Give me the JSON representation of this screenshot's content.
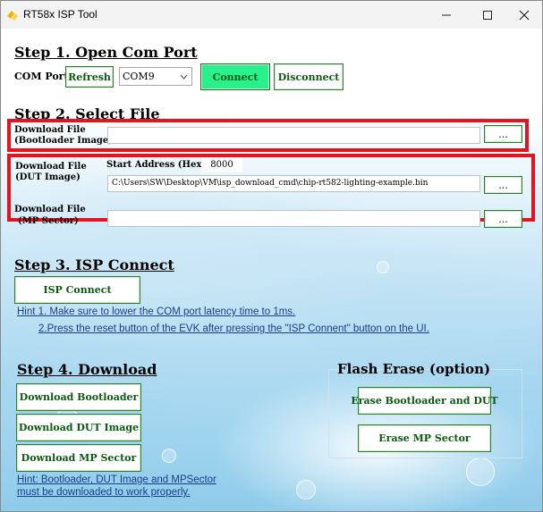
{
  "window": {
    "title": "RT58x ISP Tool"
  },
  "step1": {
    "heading": "Step 1. Open Com Port",
    "com_port_label": "COM Port",
    "refresh_label": "Refresh",
    "com_port_value": "COM9",
    "connect_label": "Connect",
    "disconnect_label": "Disconnect"
  },
  "step2": {
    "heading": "Step 2. Select File",
    "bootloader_label_line1": "Download File",
    "bootloader_label_line2": "(Bootloader Image)",
    "bootloader_path": "",
    "dut_label_line1": "Download File",
    "dut_label_line2": "(DUT Image)",
    "start_address_label": "Start Address (Hex)",
    "start_address_value": "8000",
    "dut_path": "C:\\Users\\SW\\Desktop\\VM\\isp_download_cmd\\chip-rt582-lighting-example.bin",
    "mp_label_line1": "Download File",
    "mp_label_line2": "(MP Sector)",
    "mp_path": "",
    "browse_label": "..."
  },
  "step3": {
    "heading": "Step 3. ISP Connect",
    "isp_connect_label": "ISP Connect",
    "hint1": "Hint 1. Make sure to lower the COM port latency time to 1ms.",
    "hint2": "2.Press the reset button of the EVK after pressing the \"ISP Connent\" button on the UI."
  },
  "step4": {
    "heading": "Step 4. Download",
    "download_bootloader_label": "Download Bootloader",
    "download_dut_label": "Download DUT Image",
    "download_mp_label": "Download MP Sector",
    "hint_line1": "Hint:  Bootloader, DUT Image and MPSector",
    "hint_line2": "must be downloaded to work properly."
  },
  "flash_erase": {
    "heading": "Flash Erase (option)",
    "erase_bootloader_dut_label": "Erase Bootloader and DUT",
    "erase_mp_label": "Erase MP Sector"
  },
  "colors": {
    "connect_green": "#28f08a",
    "highlight_red": "#e3131f",
    "button_text_green": "#0c5a12",
    "hint_blue": "#1a3d8a"
  }
}
